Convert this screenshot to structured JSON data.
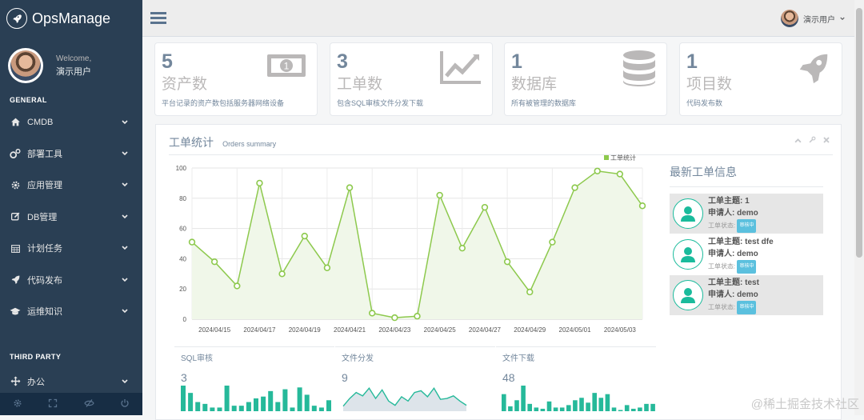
{
  "brand": {
    "name": "OpsManage",
    "logo_icon": "rocket-icon"
  },
  "profile": {
    "welcome": "Welcome,",
    "name": "演示用户"
  },
  "sidebar": {
    "section_general": "GENERAL",
    "items": [
      {
        "label": "CMDB",
        "icon": "home-icon"
      },
      {
        "label": "部署工具",
        "icon": "cogs-icon"
      },
      {
        "label": "应用管理",
        "icon": "gear-icon"
      },
      {
        "label": "DB管理",
        "icon": "edit-icon"
      },
      {
        "label": "计划任务",
        "icon": "calendar-icon"
      },
      {
        "label": "代码发布",
        "icon": "rocket-icon"
      },
      {
        "label": "运维知识",
        "icon": "graduation-cap-icon"
      }
    ],
    "section_third": "THIRD PARTY",
    "third_items": [
      {
        "label": "办公",
        "icon": "arrows-icon"
      }
    ],
    "footer_icons": [
      "settings-icon",
      "fullscreen-icon",
      "eye-slash-icon",
      "power-icon"
    ]
  },
  "topbar": {
    "user": "演示用户"
  },
  "tiles": [
    {
      "count": "5",
      "title": "资产数",
      "desc": "平台记录的资产数包括服务器网络设备",
      "icon": "money-icon"
    },
    {
      "count": "3",
      "title": "工单数",
      "desc": "包含SQL审核文件分发下载",
      "icon": "area-chart-icon"
    },
    {
      "count": "1",
      "title": "数据库",
      "desc": "所有被管理的数据库",
      "icon": "database-icon"
    },
    {
      "count": "1",
      "title": "项目数",
      "desc": "代码发布数",
      "icon": "rocket-icon"
    }
  ],
  "panel": {
    "title": "工单统计",
    "subtitle": "Orders summary"
  },
  "orders": {
    "title": "最新工单信息",
    "subject_label": "工单主题:",
    "applicant_label": "申请人:",
    "status_label": "工单状态:",
    "items": [
      {
        "subject": "1",
        "applicant": "demo",
        "status": "审核中"
      },
      {
        "subject": "test dfe",
        "applicant": "demo",
        "status": "审核中"
      },
      {
        "subject": "test",
        "applicant": "demo",
        "status": "审核中"
      }
    ]
  },
  "minis": [
    {
      "title": "SQL审核",
      "count": "3"
    },
    {
      "title": "文件分发",
      "count": "9"
    },
    {
      "title": "文件下载",
      "count": "48"
    }
  ],
  "watermark": "@稀土掘金技术社区",
  "colors": {
    "sidebar": "#2a3f54",
    "line": "#8dc94d",
    "green": "#1abb9c",
    "area": "#f0f7e9"
  },
  "chart_data": {
    "type": "line",
    "legend": "工单统计",
    "legend_position": "top-right",
    "grid": true,
    "ylim": [
      0,
      100
    ],
    "yticks": [
      0,
      20,
      40,
      60,
      80,
      100
    ],
    "x": [
      "2024/04/14",
      "2024/04/15",
      "2024/04/16",
      "2024/04/17",
      "2024/04/18",
      "2024/04/19",
      "2024/04/20",
      "2024/04/21",
      "2024/04/22",
      "2024/04/23",
      "2024/04/24",
      "2024/04/25",
      "2024/04/26",
      "2024/04/27",
      "2024/04/28",
      "2024/04/29",
      "2024/04/30",
      "2024/05/01",
      "2024/05/02",
      "2024/05/03",
      "2024/05/04"
    ],
    "xtick_labels": [
      "2024/04/15",
      "2024/04/17",
      "2024/04/19",
      "2024/04/21",
      "2024/04/23",
      "2024/04/25",
      "2024/04/27",
      "2024/04/29",
      "2024/05/01",
      "2024/05/03"
    ],
    "values": [
      51,
      38,
      22,
      90,
      30,
      55,
      34,
      87,
      4,
      1,
      2,
      82,
      47,
      74,
      38,
      18,
      51,
      87,
      98,
      96,
      75
    ],
    "sparklines": [
      {
        "type": "bar",
        "values": [
          14,
          10,
          5,
          4,
          2,
          2,
          14,
          3,
          3,
          5,
          7,
          8,
          11,
          5,
          12,
          2,
          13,
          9,
          3,
          2,
          6
        ]
      },
      {
        "type": "line",
        "values": [
          4,
          13,
          20,
          16,
          25,
          13,
          23,
          10,
          5,
          15,
          10,
          20,
          22,
          15,
          25,
          12,
          13,
          16,
          10,
          5
        ]
      },
      {
        "type": "bar",
        "values": [
          14,
          4,
          9,
          21,
          6,
          3,
          2,
          8,
          3,
          3,
          5,
          9,
          11,
          7,
          15,
          11,
          14,
          3,
          1,
          5,
          2,
          3,
          6,
          6
        ]
      }
    ]
  }
}
